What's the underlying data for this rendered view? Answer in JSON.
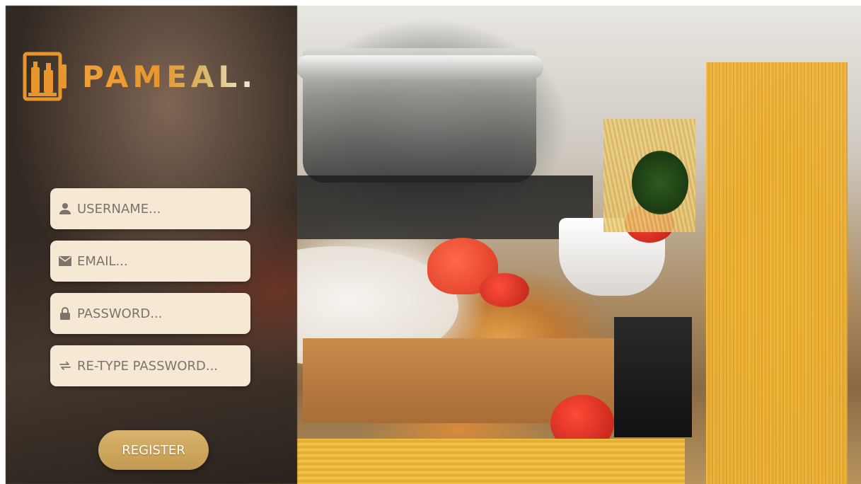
{
  "brand": {
    "name": "PAMEAL.",
    "accent": "#e89a2b",
    "icon": "bottles-logo-icon"
  },
  "form": {
    "username": {
      "placeholder": "USERNAME...",
      "icon": "user-icon"
    },
    "email": {
      "placeholder": "EMAIL...",
      "icon": "envelope-icon"
    },
    "password": {
      "placeholder": "PASSWORD...",
      "icon": "lock-icon"
    },
    "retype_password": {
      "placeholder": "RE-TYPE PASSWORD...",
      "icon": "repeat-icon"
    },
    "field_color": "#f6e9d3"
  },
  "actions": {
    "register_label": "REGISTER",
    "register_color": "#c8a058"
  }
}
